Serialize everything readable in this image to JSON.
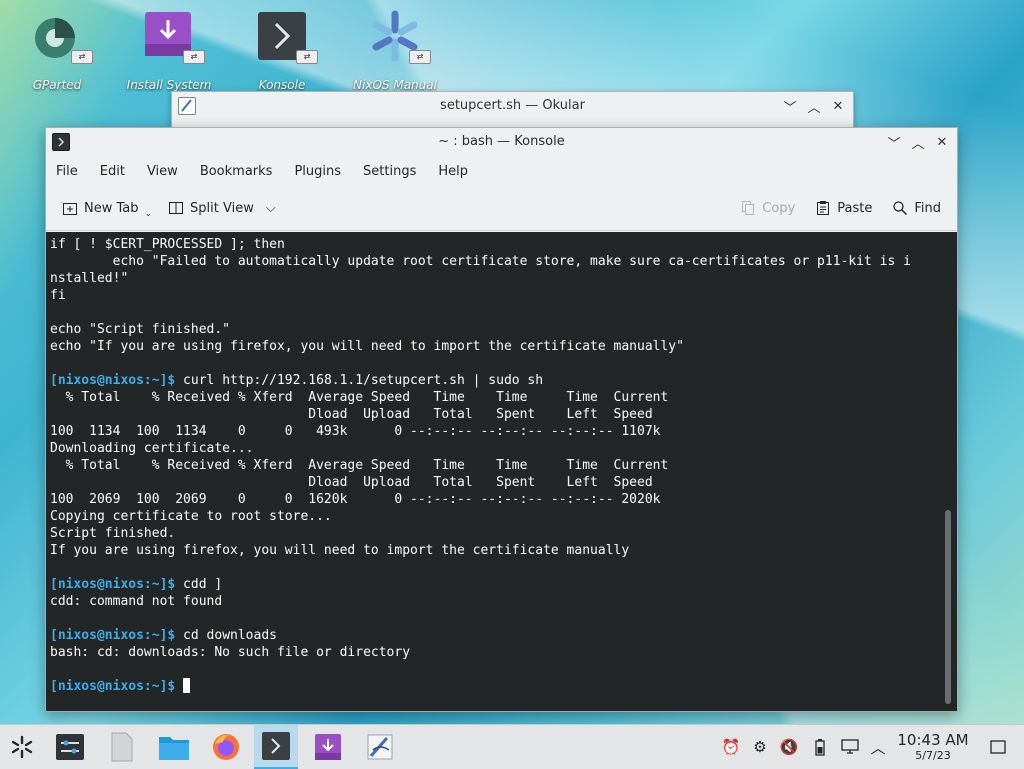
{
  "desktop": {
    "icons": [
      {
        "label": "GParted",
        "icon": "gparted-icon"
      },
      {
        "label": "Install System",
        "icon": "install-system-icon"
      },
      {
        "label": "Konsole",
        "icon": "konsole-icon"
      },
      {
        "label": "NixOS Manual",
        "icon": "nixos-manual-icon"
      }
    ]
  },
  "okular": {
    "title": "setupcert.sh — Okular"
  },
  "konsole": {
    "title": "~ : bash — Konsole",
    "menu": [
      "File",
      "Edit",
      "View",
      "Bookmarks",
      "Plugins",
      "Settings",
      "Help"
    ],
    "toolbar": {
      "new_tab": "New Tab",
      "split_view": "Split View",
      "copy": "Copy",
      "paste": "Paste",
      "find": "Find"
    },
    "terminal": {
      "prompt": "[nixos@nixos:~]$",
      "lines": [
        {
          "t": "text",
          "s": "if [ ! $CERT_PROCESSED ]; then"
        },
        {
          "t": "text",
          "s": "        echo \"Failed to automatically update root certificate store, make sure ca-certificates or p11-kit is i"
        },
        {
          "t": "text",
          "s": "nstalled!\""
        },
        {
          "t": "text",
          "s": "fi"
        },
        {
          "t": "text",
          "s": ""
        },
        {
          "t": "text",
          "s": "echo \"Script finished.\""
        },
        {
          "t": "text",
          "s": "echo \"If you are using firefox, you will need to import the certificate manually\""
        },
        {
          "t": "text",
          "s": ""
        },
        {
          "t": "cmd",
          "s": " curl http://192.168.1.1/setupcert.sh | sudo sh"
        },
        {
          "t": "text",
          "s": "  % Total    % Received % Xferd  Average Speed   Time    Time     Time  Current"
        },
        {
          "t": "text",
          "s": "                                 Dload  Upload   Total   Spent    Left  Speed"
        },
        {
          "t": "text",
          "s": "100  1134  100  1134    0     0   493k      0 --:--:-- --:--:-- --:--:-- 1107k"
        },
        {
          "t": "text",
          "s": "Downloading certificate..."
        },
        {
          "t": "text",
          "s": "  % Total    % Received % Xferd  Average Speed   Time    Time     Time  Current"
        },
        {
          "t": "text",
          "s": "                                 Dload  Upload   Total   Spent    Left  Speed"
        },
        {
          "t": "text",
          "s": "100  2069  100  2069    0     0  1620k      0 --:--:-- --:--:-- --:--:-- 2020k"
        },
        {
          "t": "text",
          "s": "Copying certificate to root store..."
        },
        {
          "t": "text",
          "s": "Script finished."
        },
        {
          "t": "text",
          "s": "If you are using firefox, you will need to import the certificate manually"
        },
        {
          "t": "text",
          "s": ""
        },
        {
          "t": "cmd",
          "s": " cdd ]"
        },
        {
          "t": "text",
          "s": "cdd: command not found"
        },
        {
          "t": "text",
          "s": ""
        },
        {
          "t": "cmd",
          "s": " cd downloads"
        },
        {
          "t": "text",
          "s": "bash: cd: downloads: No such file or directory"
        },
        {
          "t": "text",
          "s": ""
        },
        {
          "t": "input",
          "s": " "
        }
      ]
    }
  },
  "taskbar": {
    "clock_time": "10:43 AM",
    "clock_date": "5/7/23"
  },
  "colors": {
    "terminal_bg": "#232627",
    "prompt": "#3daee9",
    "accent": "#3daee9"
  }
}
